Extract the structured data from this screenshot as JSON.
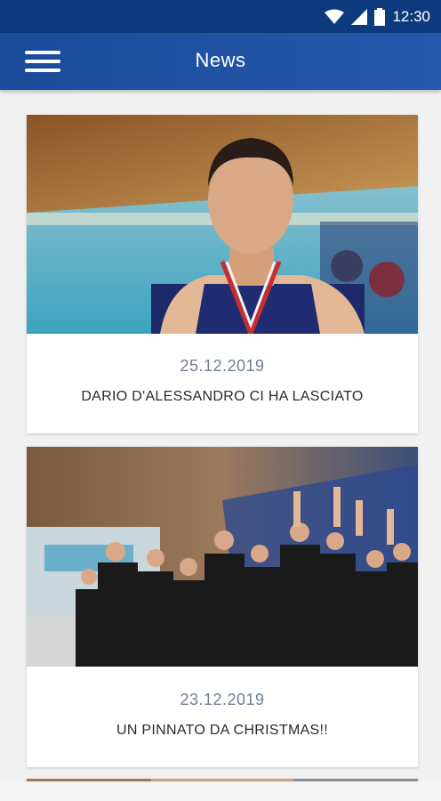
{
  "status_bar": {
    "time": "12:30",
    "icons": [
      "wifi-icon",
      "signal-icon",
      "battery-icon"
    ],
    "background": "#0d3a7d"
  },
  "app_bar": {
    "title": "News",
    "menu_icon": "hamburger-menu-icon",
    "background": "#1f52a3"
  },
  "news": [
    {
      "date": "25.12.2019",
      "title": "DARIO D'ALESSANDRO CI HA LASCIATO",
      "image": "photo-young-man-with-medal-at-pool"
    },
    {
      "date": "23.12.2019",
      "title": "UN PINNATO DA CHRISTMAS!!",
      "image": "photo-team-celebration-at-pool"
    },
    {
      "image": "photo-partially-visible"
    }
  ],
  "colors": {
    "accent": "#1f52a3",
    "date_text": "#6f7e93",
    "headline_text": "#2a2a2a"
  }
}
